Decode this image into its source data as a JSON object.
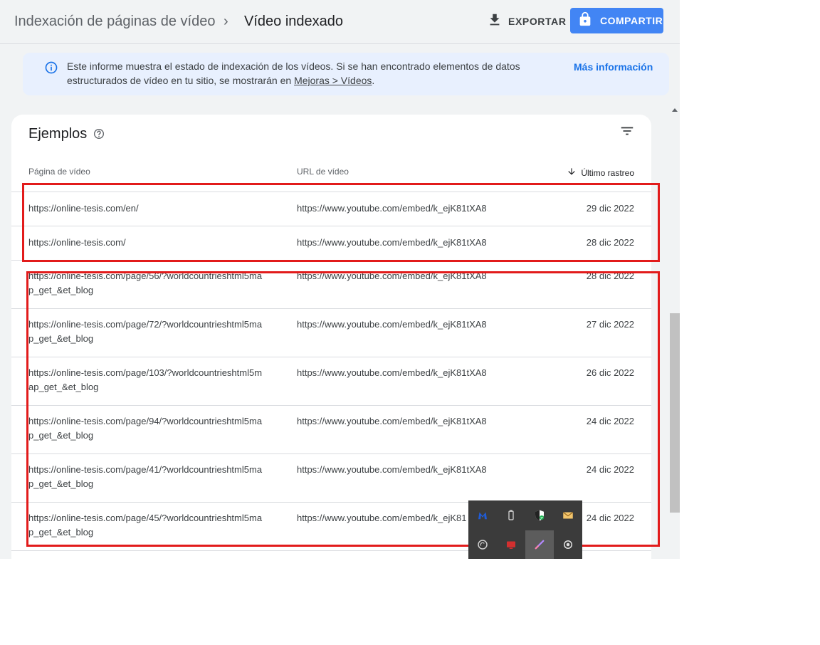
{
  "header": {
    "breadcrumb_parent": "Indexación de páginas de vídeo",
    "breadcrumb_separator": "›",
    "breadcrumb_current": "Vídeo indexado",
    "export_label": "EXPORTAR",
    "share_label": "COMPARTIR"
  },
  "banner": {
    "text_before_link": "Este informe muestra el estado de indexación de los vídeos. Si se han encontrado elementos de datos estructurados de vídeo en tu sitio, se mostrarán en ",
    "link_text": "Mejoras > Vídeos",
    "text_after_link": ".",
    "more_info": "Más información"
  },
  "examples": {
    "title": "Ejemplos",
    "columns": {
      "page": "Página de vídeo",
      "url": "URL de vídeo",
      "last_crawl": "Último rastreo"
    },
    "rows": [
      {
        "page": "https://online-tesis.com/en/",
        "url": "https://www.youtube.com/embed/k_ejK81tXA8",
        "date": "29 dic 2022"
      },
      {
        "page": "https://online-tesis.com/",
        "url": "https://www.youtube.com/embed/k_ejK81tXA8",
        "date": "28 dic 2022"
      },
      {
        "page": "https://online-tesis.com/page/56/?worldcountrieshtml5map_get_&et_blog",
        "url": "https://www.youtube.com/embed/k_ejK81tXA8",
        "date": "28 dic 2022"
      },
      {
        "page": "https://online-tesis.com/page/72/?worldcountrieshtml5map_get_&et_blog",
        "url": "https://www.youtube.com/embed/k_ejK81tXA8",
        "date": "27 dic 2022"
      },
      {
        "page": "https://online-tesis.com/page/103/?worldcountrieshtml5map_get_&et_blog",
        "url": "https://www.youtube.com/embed/k_ejK81tXA8",
        "date": "26 dic 2022"
      },
      {
        "page": "https://online-tesis.com/page/94/?worldcountrieshtml5map_get_&et_blog",
        "url": "https://www.youtube.com/embed/k_ejK81tXA8",
        "date": "24 dic 2022"
      },
      {
        "page": "https://online-tesis.com/page/41/?worldcountrieshtml5map_get_&et_blog",
        "url": "https://www.youtube.com/embed/k_ejK81tXA8",
        "date": "24 dic 2022"
      },
      {
        "page": "https://online-tesis.com/page/45/?worldcountrieshtml5map_get_&et_blog",
        "url": "https://www.youtube.com/embed/k_ejK81",
        "date": "24 dic 2022"
      }
    ]
  },
  "icons": {
    "export": "download-icon",
    "share": "lock-icon",
    "info": "info-icon",
    "help": "help-circle-icon",
    "filter": "filter-icon",
    "sort": "arrow-down-icon"
  },
  "tray_icons": [
    "malwarebytes-icon",
    "usb-icon",
    "shield-icon",
    "mail-icon",
    "sync-icon",
    "monitor-icon",
    "pen-icon",
    "record-icon"
  ],
  "colors": {
    "accent": "#4285f4",
    "link": "#1a73e8",
    "banner_bg": "#e8f0fe",
    "highlight": "#e21b1b"
  }
}
